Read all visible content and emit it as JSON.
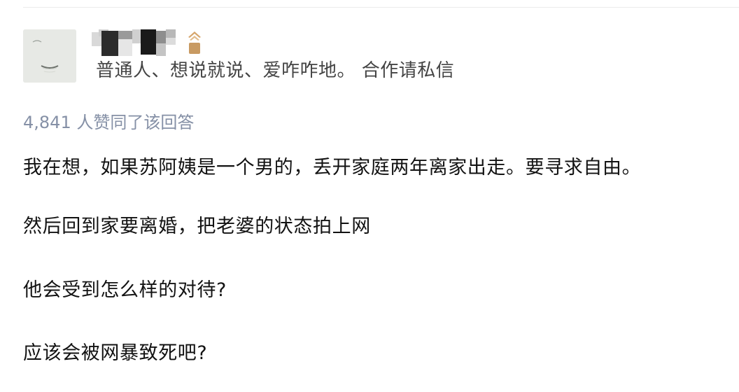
{
  "author": {
    "bio": "普通人、想说就说、爱咋咋地。 合作请私信",
    "avatar_icon": "avatar-image",
    "badge_icon": "creator-badge-icon",
    "colors": {
      "bio": "#444444",
      "badge_top": "#d6a56b",
      "badge_bottom": "#b98a55"
    }
  },
  "answer": {
    "vote_text": "4,841 人赞同了该回答",
    "paragraphs": [
      "我在想，如果苏阿姨是一个男的，丢开家庭两年离家出走。要寻求自由。",
      "然后回到家要离婚，把老婆的状态拍上网",
      "他会受到怎么样的对待?",
      "应该会被网暴致死吧?"
    ],
    "colors": {
      "vote_text": "#8590a6",
      "body_text": "#121212"
    }
  }
}
